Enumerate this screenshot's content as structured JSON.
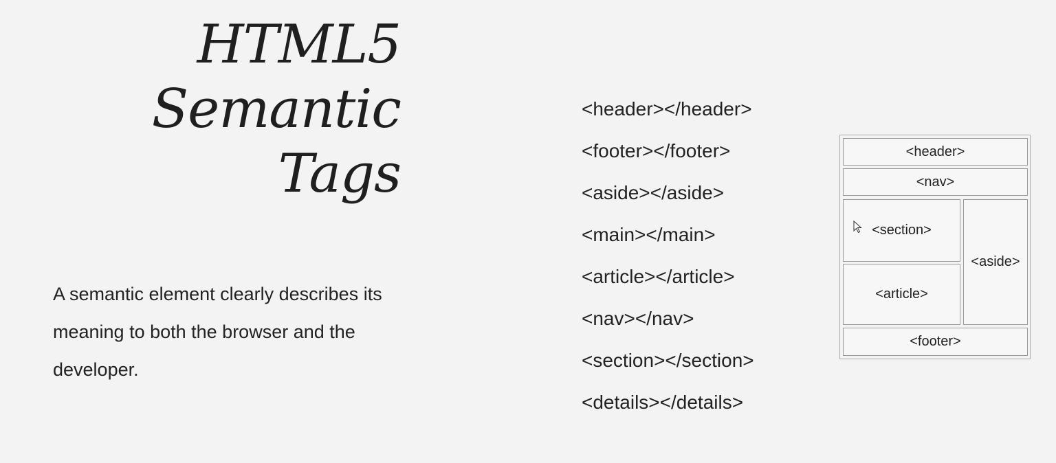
{
  "slide": {
    "title_lines": [
      "HTML5",
      "Semantic",
      "Tags"
    ],
    "description": "A semantic element clearly describes its meaning to both the browser and the developer.",
    "tags": [
      "<header></header>",
      "<footer></footer>",
      "<aside></aside>",
      "<main></main>",
      "<article></article>",
      "<nav></nav>",
      "<section></section>",
      "<details></details>"
    ]
  },
  "diagram": {
    "header": "<header>",
    "nav": "<nav>",
    "section": "<section>",
    "article": "<article>",
    "aside": "<aside>",
    "footer": "<footer>"
  },
  "cursor": {
    "icon": "mouse-pointer-icon"
  }
}
